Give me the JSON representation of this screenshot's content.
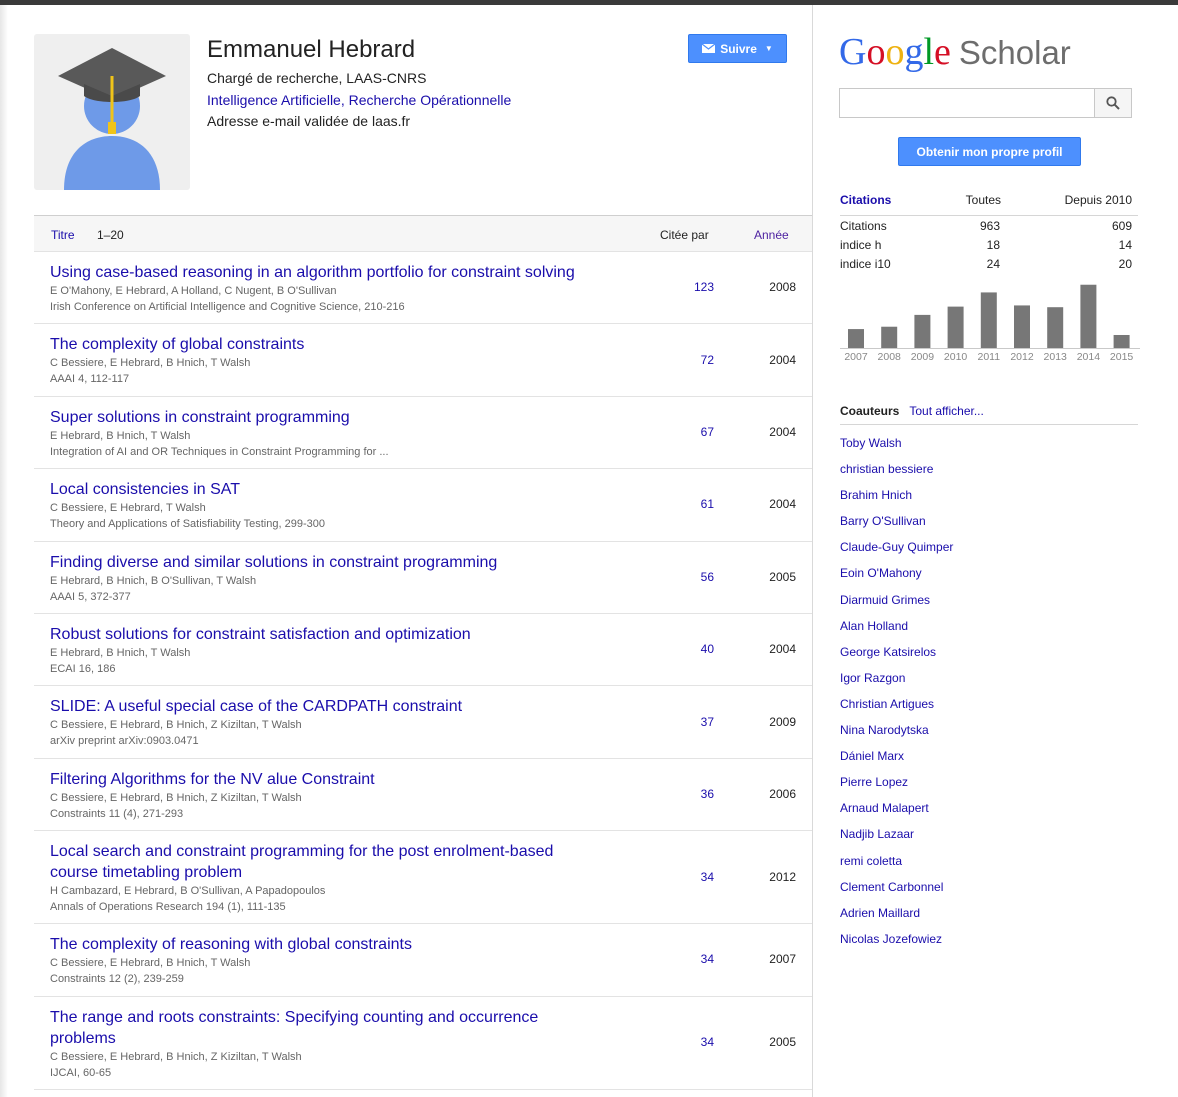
{
  "profile": {
    "name": "Emmanuel Hebrard",
    "affiliation": "Chargé de recherche, LAAS-CNRS",
    "interests": "Intelligence Artificielle, Recherche Opérationnelle",
    "email_note": "Adresse e-mail validée de laas.fr",
    "follow_label": "Suivre"
  },
  "table": {
    "title_header": "Titre",
    "range": "1–20",
    "cited_header": "Citée par",
    "year_header": "Année",
    "rows": [
      {
        "title_lines": [
          "Using case-based reasoning in an algorithm portfolio for constraint solving"
        ],
        "authors": "E O'Mahony, E Hebrard, A Holland, C Nugent, B O'Sullivan",
        "venue": "Irish Conference on Artificial Intelligence and Cognitive Science, 210-216",
        "cited": "123",
        "year": "2008"
      },
      {
        "title_lines": [
          "The complexity of global constraints"
        ],
        "authors": "C Bessiere, E Hebrard, B Hnich, T Walsh",
        "venue": "AAAI 4, 112-117",
        "cited": "72",
        "year": "2004"
      },
      {
        "title_lines": [
          "Super solutions in constraint programming"
        ],
        "authors": "E Hebrard, B Hnich, T Walsh",
        "venue": "Integration of AI and OR Techniques in Constraint Programming for ...",
        "cited": "67",
        "year": "2004"
      },
      {
        "title_lines": [
          "Local consistencies in SAT"
        ],
        "authors": "C Bessiere, E Hebrard, T Walsh",
        "venue": "Theory and Applications of Satisfiability Testing, 299-300",
        "cited": "61",
        "year": "2004"
      },
      {
        "title_lines": [
          "Finding diverse and similar solutions in constraint programming"
        ],
        "authors": "E Hebrard, B Hnich, B O'Sullivan, T Walsh",
        "venue": "AAAI 5, 372-377",
        "cited": "56",
        "year": "2005"
      },
      {
        "title_lines": [
          "Robust solutions for constraint satisfaction and optimization"
        ],
        "authors": "E Hebrard, B Hnich, T Walsh",
        "venue": "ECAI 16, 186",
        "cited": "40",
        "year": "2004"
      },
      {
        "title_lines": [
          "SLIDE: A useful special case of the CARDPATH constraint"
        ],
        "authors": "C Bessiere, E Hebrard, B Hnich, Z Kiziltan, T Walsh",
        "venue": "arXiv preprint arXiv:0903.0471",
        "cited": "37",
        "year": "2009"
      },
      {
        "title_lines": [
          "Filtering Algorithms for the NV alue Constraint"
        ],
        "authors": "C Bessiere, E Hebrard, B Hnich, Z Kiziltan, T Walsh",
        "venue": "Constraints 11 (4), 271-293",
        "cited": "36",
        "year": "2006"
      },
      {
        "title_lines": [
          "Local search and constraint programming for the post enrolment-based",
          "course timetabling problem"
        ],
        "authors": "H Cambazard, E Hebrard, B O'Sullivan, A Papadopoulos",
        "venue": "Annals of Operations Research 194 (1), 111-135",
        "cited": "34",
        "year": "2012"
      },
      {
        "title_lines": [
          "The complexity of reasoning with global constraints"
        ],
        "authors": "C Bessiere, E Hebrard, B Hnich, T Walsh",
        "venue": "Constraints 12 (2), 239-259",
        "cited": "34",
        "year": "2007"
      },
      {
        "title_lines": [
          "The range and roots constraints: Specifying counting and occurrence",
          "problems"
        ],
        "authors": "C Bessiere, E Hebrard, B Hnich, Z Kiziltan, T Walsh",
        "venue": "IJCAI, 60-65",
        "cited": "34",
        "year": "2005"
      }
    ]
  },
  "sidebar": {
    "logo_google": "Google",
    "logo_scholar": "Scholar",
    "search_placeholder": "",
    "own_profile_label": "Obtenir mon propre profil",
    "stats": {
      "header": [
        "Citations",
        "Toutes",
        "Depuis 2010"
      ],
      "rows": [
        [
          "Citations",
          "963",
          "609"
        ],
        [
          "indice h",
          "18",
          "14"
        ],
        [
          "indice i10",
          "24",
          "20"
        ]
      ]
    },
    "coauthors_label": "Coauteurs",
    "show_all_label": "Tout afficher...",
    "coauthors": [
      "Toby Walsh",
      "christian bessiere",
      "Brahim Hnich",
      "Barry O'Sullivan",
      "Claude-Guy Quimper",
      "Eoin O'Mahony",
      "Diarmuid Grimes",
      "Alan Holland",
      "George Katsirelos",
      "Igor Razgon",
      "Christian Artigues",
      "Nina Narodytska",
      "Dániel Marx",
      "Pierre Lopez",
      "Arnaud Malapert",
      "Nadjib Lazaar",
      "remi coletta",
      "Clement Carbonnel",
      "Adrien Maillard",
      "Nicolas Jozefowiez"
    ]
  },
  "colors": {
    "link": "#1a0dab",
    "button": "#4d90fe",
    "bar": "#777777"
  },
  "chart_data": {
    "type": "bar",
    "categories": [
      "2007",
      "2008",
      "2009",
      "2010",
      "2011",
      "2012",
      "2013",
      "2014",
      "2015"
    ],
    "values": [
      32,
      36,
      56,
      70,
      94,
      72,
      69,
      107,
      22
    ],
    "ylim": [
      0,
      115
    ],
    "title": "",
    "xlabel": "",
    "ylabel": ""
  }
}
